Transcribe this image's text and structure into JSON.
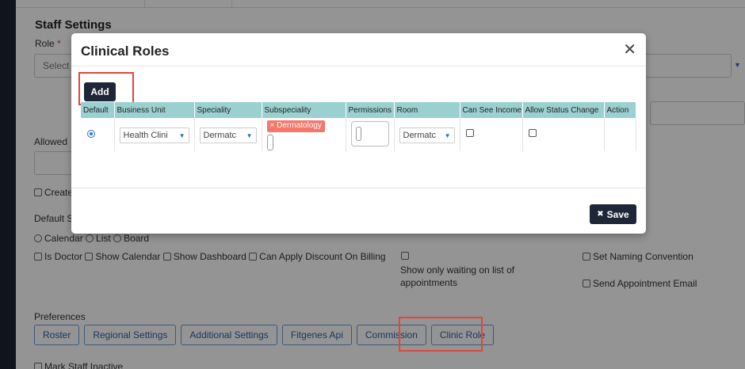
{
  "background": {
    "heading": "Staff Settings",
    "role_label": "Role",
    "role_required_mark": "*",
    "role_placeholder": "Select",
    "allowed_label": "Allowed",
    "create_label": "Create",
    "default_label": "Default S",
    "view_options": [
      "Calendar",
      "List",
      "Board"
    ],
    "checkbox_row": [
      "Is Doctor",
      "Show Calendar",
      "Show Dashboard",
      "Can Apply Discount On Billing"
    ],
    "waiting_label": "Show only waiting on list of appointments",
    "set_naming_label": "Set Naming Convention",
    "send_email_label": "Send Appointment Email",
    "preferences_label": "Preferences",
    "preference_tabs": [
      "Roster",
      "Regional Settings",
      "Additional Settings",
      "Fitgenes Api",
      "Commission",
      "Clinic Role"
    ],
    "mark_inactive_label": "Mark Staff Inactive"
  },
  "modal": {
    "title": "Clinical Roles",
    "close_glyph": "✕",
    "add_label": "Add",
    "save_label": "Save",
    "save_glyph": "✖",
    "table": {
      "headers": [
        "Default",
        "Business Unit",
        "Speciality",
        "Subspeciality",
        "Permissions",
        "Room",
        "Can See Income",
        "Allow Status Change",
        "Action"
      ],
      "row": {
        "default_selected": true,
        "business_unit": "Health Clini",
        "speciality": "Dermatc",
        "subspeciality_tag": "Dermatology",
        "subspeciality_tag_remove": "×",
        "room": "Dermatc"
      }
    }
  },
  "colors": {
    "accent_dark": "#1e2737",
    "table_header": "#9bd0d0",
    "tag": "#f4776b",
    "highlight": "#e2453c",
    "link_blue": "#2f5f9e"
  }
}
